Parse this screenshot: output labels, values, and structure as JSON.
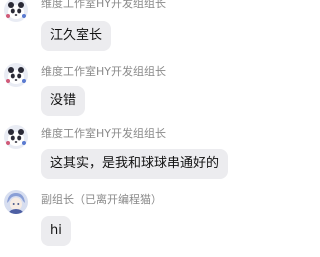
{
  "messages": [
    {
      "sender": "维度工作室HY开发组组长",
      "text": "江久室长",
      "avatar": "panda-icon"
    },
    {
      "sender": "维度工作室HY开发组组长",
      "text": "没错",
      "avatar": "panda-icon"
    },
    {
      "sender": "维度工作室HY开发组组长",
      "text": "这其实，是我和球球串通好的",
      "avatar": "panda-icon"
    },
    {
      "sender": "副组长（已离开编程猫）",
      "text": "hi",
      "avatar": "anime-character-icon"
    }
  ],
  "colors": {
    "bubble": "#ececef",
    "sender_text": "#8a8a8a",
    "message_text": "#111111",
    "background": "#ffffff"
  }
}
